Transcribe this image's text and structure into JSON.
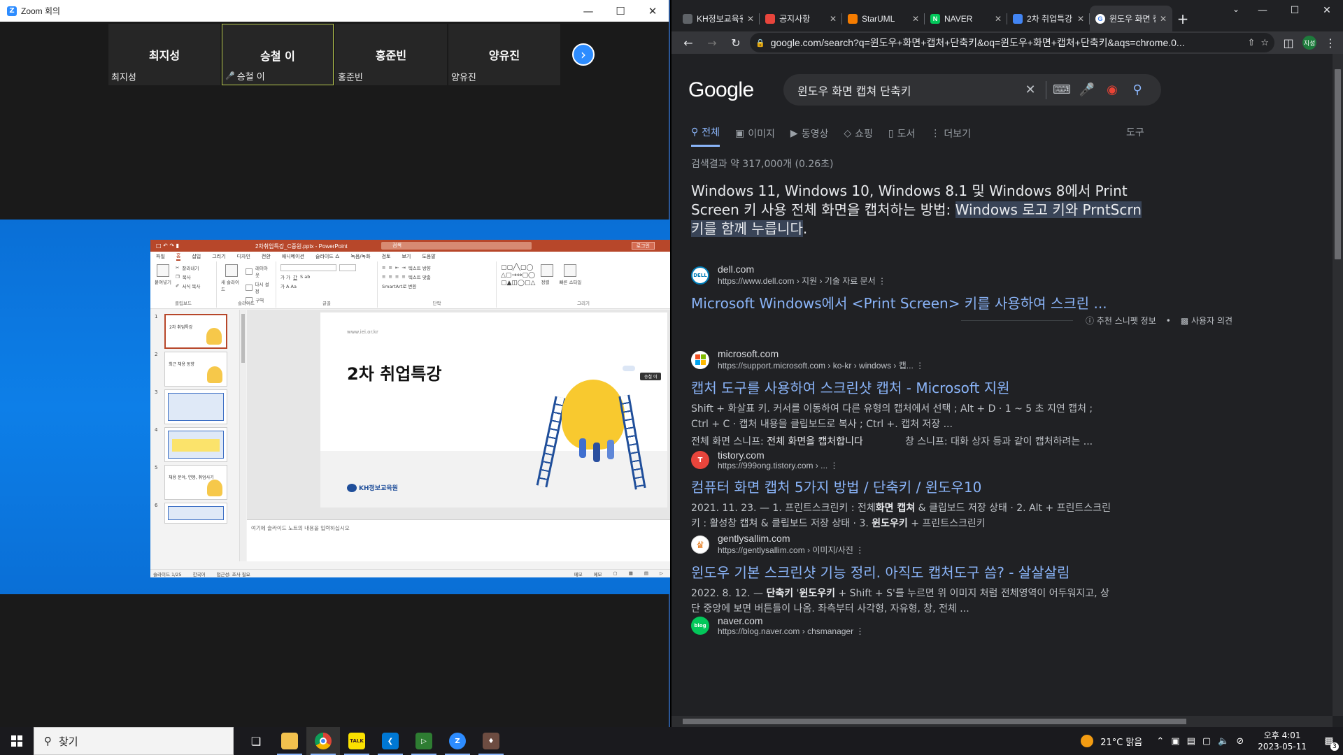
{
  "zoom": {
    "window_title": "Zoom 회의",
    "participants": [
      {
        "name": "최지성",
        "label": "최지성",
        "active": false,
        "muted": false
      },
      {
        "name": "승철 이",
        "label": "승철 이",
        "active": true,
        "muted": true
      },
      {
        "name": "홍준빈",
        "label": "홍준빈",
        "active": false,
        "muted": false
      },
      {
        "name": "양유진",
        "label": "양유진",
        "active": false,
        "muted": false
      }
    ]
  },
  "powerpoint": {
    "document_title": "2차취업특강_C중원.pptx - PowerPoint",
    "search_placeholder": "검색",
    "login_label": "로그인",
    "tabs": [
      "파일",
      "홈",
      "삽입",
      "그리기",
      "디자인",
      "전환",
      "애니메이션",
      "슬라이드 쇼",
      "녹음/녹화",
      "검토",
      "보기",
      "도움말"
    ],
    "active_tab": "홈",
    "ribbon_groups": {
      "clipboard": {
        "label": "클립보드",
        "paste": "붙여넣기",
        "cut": "잘라내기",
        "copy": "복사",
        "format_painter": "서식 복사"
      },
      "slides": {
        "label": "슬라이드",
        "new_slide": "새 슬라이드",
        "layout": "레이아웃",
        "reset": "다시 설정",
        "section": "구역"
      },
      "font": {
        "label": "글꼴"
      },
      "paragraph": {
        "label": "단락",
        "text_direction": "텍스트 방향",
        "align_text": "텍스트 맞춤",
        "smartart": "SmartArt로 변환"
      },
      "drawing": {
        "label": "그리기",
        "arrange": "정렬",
        "quick_styles": "빠른 스타일"
      }
    },
    "slides": [
      {
        "num": "1",
        "title": "2차 취업특강"
      },
      {
        "num": "2",
        "title": "최근 채용 동향"
      },
      {
        "num": "3",
        "title": ""
      },
      {
        "num": "4",
        "title": ""
      },
      {
        "num": "5",
        "title": "채용 분야, 연봉, 취업사기"
      },
      {
        "num": "6",
        "title": ""
      }
    ],
    "current_slide": {
      "url": "www.iei.or.kr",
      "title": "2차 취업특강",
      "logo_text": "KH정보교육원",
      "speaker_tag": "승철 이"
    },
    "notes_placeholder": "여기에 슬라이드 노트의 내용을 입력하십시오",
    "status": {
      "slide_count": "슬라이드 1/25",
      "language": "한국어",
      "accessibility": "접근성: 조사 필요",
      "notes": "메모",
      "comments": "메모"
    }
  },
  "chrome": {
    "tabs": [
      {
        "title": "KH정보교육원",
        "favicon": "globe-icon",
        "color": "#5f6368",
        "active": false
      },
      {
        "title": "공지사항",
        "favicon": "grid-icon",
        "color": "#e8453c",
        "active": false
      },
      {
        "title": "StarUML",
        "favicon": "diamond-icon",
        "color": "#f57c00",
        "active": false
      },
      {
        "title": "NAVER",
        "favicon": "naver-icon",
        "color": "#03c75a",
        "active": false
      },
      {
        "title": "2차 취업특강",
        "favicon": "doc-icon",
        "color": "#4285f4",
        "active": false
      },
      {
        "title": "윈도우 화면 캡쳐 단축키",
        "favicon": "google-icon",
        "color": "#ffffff",
        "active": true
      }
    ],
    "url": "google.com/search?q=윈도우+화면+캡처+단축키&oq=윈도우+화면+캡처+단축키&aqs=chrome.0...",
    "profile_initial": "지성"
  },
  "google": {
    "logo": "Google",
    "query": "윈도우 화면 캡쳐 단축키",
    "tabs": [
      {
        "label": "전체",
        "icon": "search-icon",
        "active": true
      },
      {
        "label": "이미지",
        "icon": "image-icon",
        "active": false
      },
      {
        "label": "동영상",
        "icon": "video-icon",
        "active": false
      },
      {
        "label": "쇼핑",
        "icon": "tag-icon",
        "active": false
      },
      {
        "label": "도서",
        "icon": "book-icon",
        "active": false
      },
      {
        "label": "더보기",
        "icon": "more-icon",
        "active": false
      }
    ],
    "tools": "도구",
    "stats": "검색결과 약 317,000개 (0.26초)",
    "snippet_plain": "Windows 11, Windows 10, Windows 8.1 및 Windows 8에서 Print Screen 키 사용 전체 화면을 캡처하는 방법: ",
    "snippet_highlight": "Windows 로고 키와 PrntScrn 키를 함께 누릅니다",
    "snippet_end": ".",
    "feedback": {
      "about": "추천 스니펫 정보",
      "feedback": "사용자 의견"
    },
    "results": [
      {
        "site": "dell.com",
        "url": "https://www.dell.com › 지원 › 기술 자료 문서",
        "title": "Microsoft Windows에서 <Print Screen> 키를 사용하여 스크린 ...",
        "desc": "",
        "fav_color": "#ffffff",
        "fav_text": "DELL"
      },
      {
        "site": "microsoft.com",
        "url": "https://support.microsoft.com › ko-kr › windows › 캡...",
        "title": "캡처 도구를 사용하여 스크린샷 캡처 - Microsoft 지원",
        "desc": "Shift + 화살표 키. 커서를 이동하여 다른 유형의 캡처에서 선택 ; Alt + D · 1 ~ 5 초 지연 캡처 ; Ctrl + C · 캡처 내용을 클립보드로 복사 ; Ctrl +. 캡처 저장 ...",
        "sub_left_label": "전체 화면 스니프: ",
        "sub_left_bold": "전체 화면을 캡처합니다",
        "sub_right": "창 스니프: 대화 상자 등과 같이 캡처하려는 ...",
        "fav_color": "#ffffff",
        "fav_text": "MS"
      },
      {
        "site": "tistory.com",
        "url": "https://999ong.tistory.com › ...",
        "title": "컴퓨터 화면 캡처 5가지 방법 / 단축키 / 윈도우10",
        "desc_parts": [
          "2021. 11. 23. — 1. 프린트스크린키 : 전체",
          "화면 캡쳐",
          " & 클립보드 저장 상태 · 2. Alt + 프린트스크린키 : 활성창 캡쳐 & 클립보드 저장 상태 · 3. ",
          "윈도우키",
          " + 프린트스크린키"
        ],
        "fav_color": "#e8453c",
        "fav_text": "T"
      },
      {
        "site": "gentlysallim.com",
        "url": "https://gentlysallim.com › 이미지/사진",
        "title": "윈도우 기본 스크린샷 기능 정리. 아직도 캡처도구 씀? - 살살살림",
        "desc_parts": [
          "2022. 8. 12. — ",
          "단축키",
          " '",
          "윈도우키",
          " + Shift + S'를 누르면 위 이미지 처럼 전체영역이 어두워지고, 상단 중앙에 보면 버튼들이 나옴. 좌측부터 사각형, 자유형, 창, 전체 ..."
        ],
        "fav_color": "#ffffff",
        "fav_text": "살"
      },
      {
        "site": "naver.com",
        "url": "https://blog.naver.com › chsmanager",
        "title": "",
        "desc": "",
        "fav_color": "#03c75a",
        "fav_text": "blog"
      }
    ]
  },
  "taskbar": {
    "search_placeholder": "찾기",
    "apps": [
      {
        "name": "task-view",
        "color": "transparent",
        "text": ""
      },
      {
        "name": "file-explorer",
        "color": "#f2c14e",
        "text": ""
      },
      {
        "name": "chrome",
        "color": "#db4437",
        "text": ""
      },
      {
        "name": "kakaotalk",
        "color": "#fae100",
        "text": "TALK"
      },
      {
        "name": "vscode",
        "color": "#0078d4",
        "text": ""
      },
      {
        "name": "media-app",
        "color": "#2e7d32",
        "text": ""
      },
      {
        "name": "zoom",
        "color": "#2d8cff",
        "text": "Z"
      },
      {
        "name": "game-app",
        "color": "#6d4c41",
        "text": ""
      }
    ],
    "weather": "21°C  맑음",
    "time": "오후 4:01",
    "date": "2023-05-11",
    "notifications": "3"
  }
}
